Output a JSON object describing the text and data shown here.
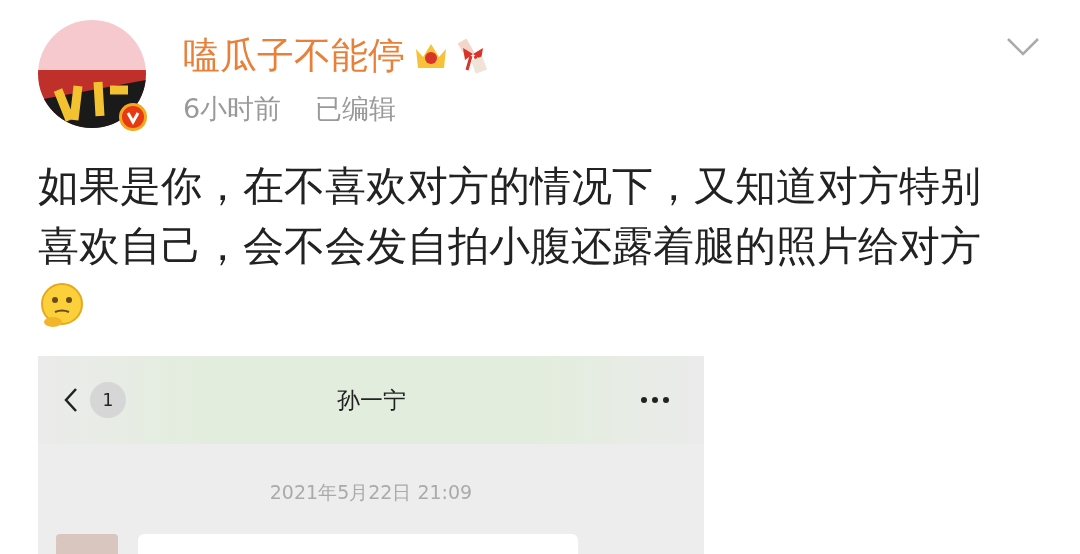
{
  "post": {
    "author": "嗑瓜子不能停",
    "time": "6小时前",
    "edited": "已编辑",
    "text": "如果是你，在不喜欢对方的情况下，又知道对方特别喜欢自己，会不会发自拍小腹还露着腿的照片给对方"
  },
  "chat_screenshot": {
    "unread_count": "1",
    "title": "孙一宁",
    "date": "2021年5月22日 21:09"
  }
}
